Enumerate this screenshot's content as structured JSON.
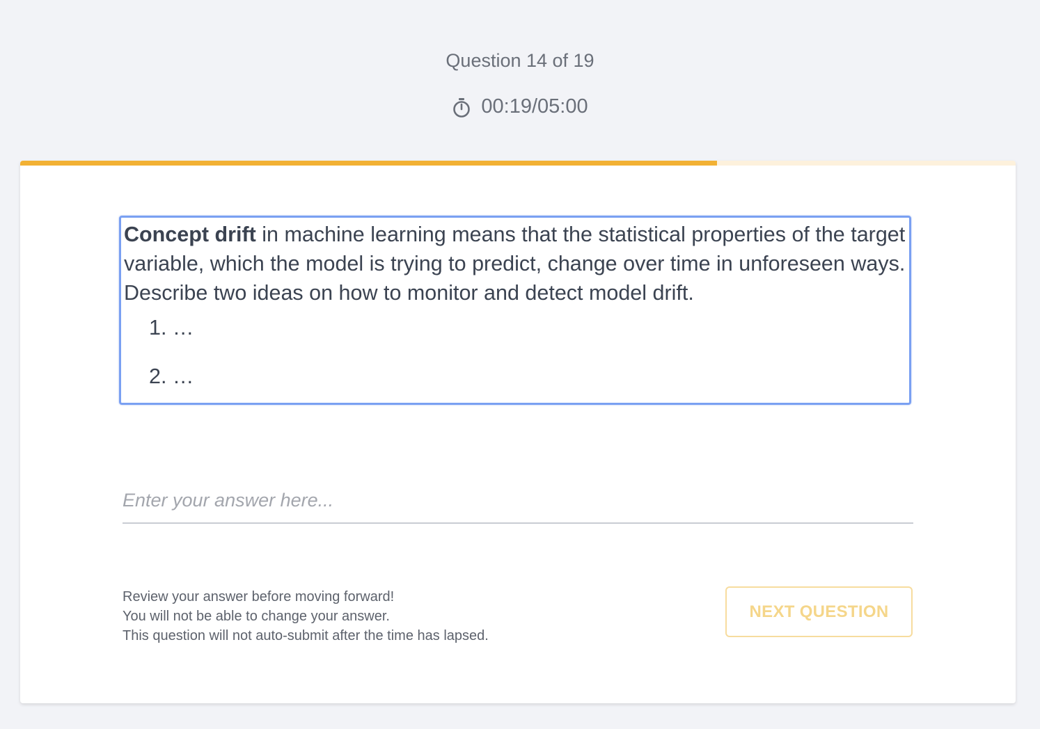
{
  "header": {
    "question_counter": "Question 14 of 19",
    "timer": "00:19/05:00",
    "timer_icon": "stopwatch-icon"
  },
  "progress": {
    "fraction": 0.7,
    "color": "#f2b134",
    "track_color": "#fdf1dc"
  },
  "question": {
    "bold_term": "Concept drift",
    "text": " in machine learning means that the statistical properties of the target variable, which the model is trying to predict, change over time in unforeseen ways. Describe two ideas on how to monitor and detect model drift.",
    "list_items": [
      "1. …",
      "2. …"
    ]
  },
  "answer": {
    "placeholder": "Enter your answer here...",
    "value": ""
  },
  "notice": {
    "line1": "Review your answer before moving forward!",
    "line2": "You will not be able to change your answer.",
    "line3": "This question will not auto-submit after the time has lapsed."
  },
  "buttons": {
    "next_label": "NEXT QUESTION"
  },
  "colors": {
    "background": "#f2f3f7",
    "accent": "#f2b134",
    "focus_border": "#7aa0f2"
  }
}
